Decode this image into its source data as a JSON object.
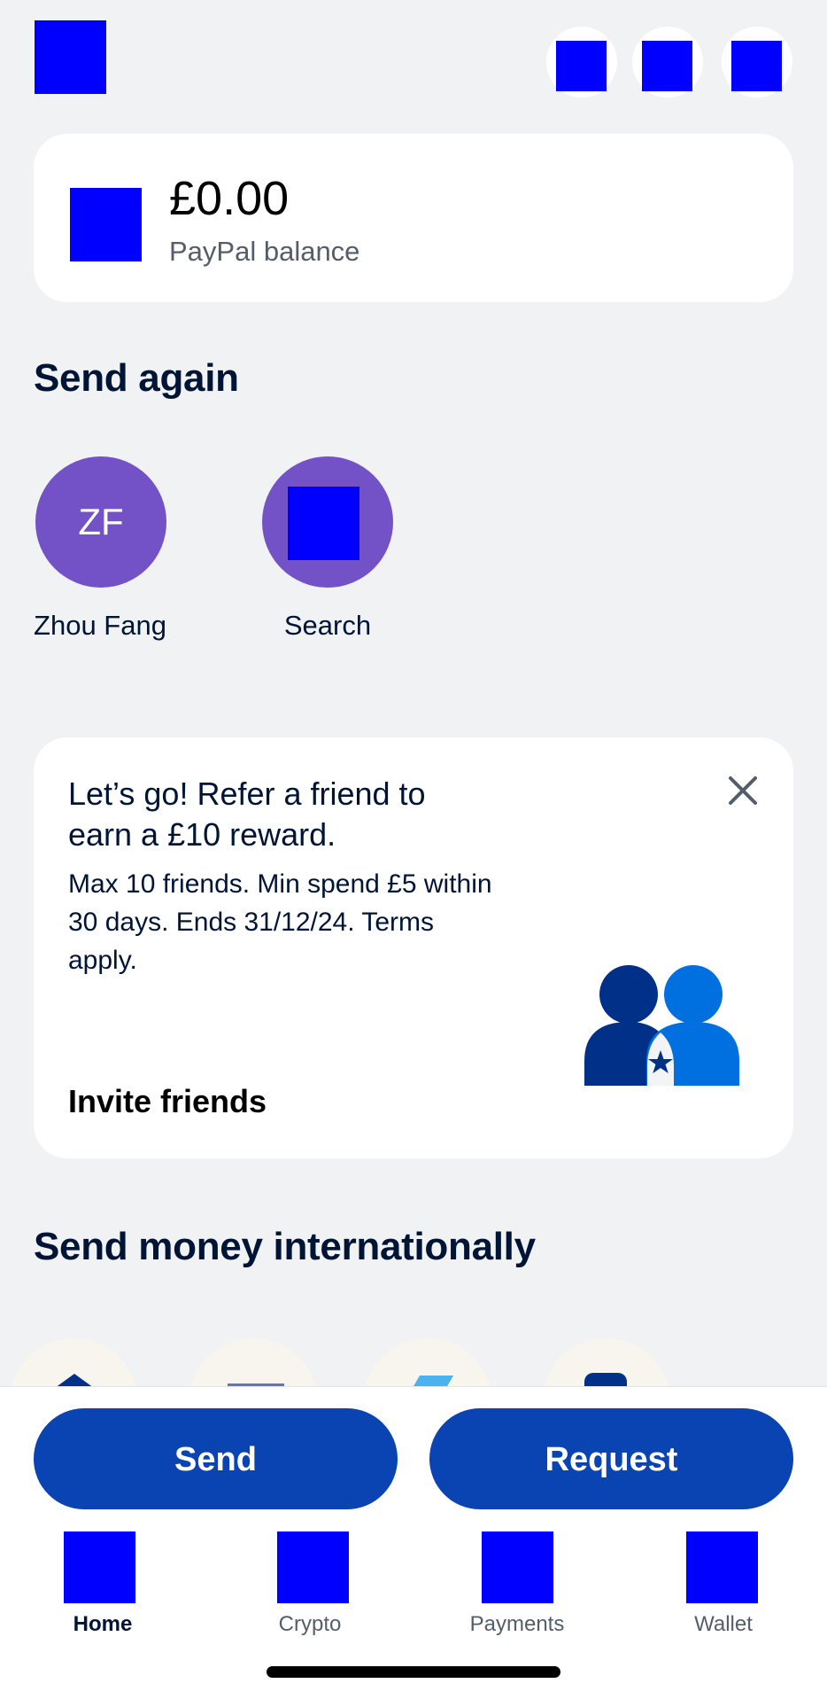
{
  "header": {
    "logo_icon": "logo-placeholder",
    "actions": [
      {
        "name": "notifications-icon"
      },
      {
        "name": "scan-icon"
      },
      {
        "name": "profile-icon"
      }
    ]
  },
  "balance": {
    "amount": "£0.00",
    "label": "PayPal balance"
  },
  "send_again": {
    "title": "Send again",
    "contacts": [
      {
        "initials": "ZF",
        "name": "Zhou Fang"
      },
      {
        "initials": "",
        "name": "Search",
        "icon": "search-icon"
      }
    ]
  },
  "promo": {
    "title": "Let’s go! Refer a friend to earn a £10 reward.",
    "body": "Max 10 friends. Min spend £5 within 30 days. Ends 31/12/24. Terms apply.",
    "cta": "Invite friends",
    "close_icon": "close-icon"
  },
  "international": {
    "title": "Send money internationally"
  },
  "actions": {
    "send": "Send",
    "request": "Request"
  },
  "nav": {
    "items": [
      {
        "label": "Home",
        "active": true
      },
      {
        "label": "Crypto",
        "active": false
      },
      {
        "label": "Payments",
        "active": false
      },
      {
        "label": "Wallet",
        "active": false
      }
    ]
  },
  "colors": {
    "background": "#f1f2f4",
    "accent_blue": "#0a43b2",
    "avatar_purple": "#7352c7",
    "text_dark": "#001435"
  }
}
